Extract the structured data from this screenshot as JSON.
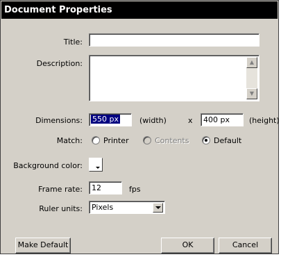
{
  "dialog": {
    "title": "Document Properties"
  },
  "form": {
    "title_label": "Title:",
    "title_value": "",
    "description_label": "Description:",
    "description_value": "",
    "dimensions_label": "Dimensions:",
    "width_value": "550 px",
    "width_unit": "(width)",
    "times": "x",
    "height_value": "400 px",
    "height_unit": "(height)",
    "match_label": "Match:",
    "match_options": [
      {
        "label": "Printer",
        "selected": false,
        "enabled": true
      },
      {
        "label": "Contents",
        "selected": false,
        "enabled": false
      },
      {
        "label": "Default",
        "selected": true,
        "enabled": true
      }
    ],
    "bg_label": "Background color:",
    "bg_color": "#ffffff",
    "frame_rate_label": "Frame rate:",
    "frame_rate_value": "12",
    "frame_rate_unit": "fps",
    "ruler_label": "Ruler units:",
    "ruler_value": "Pixels"
  },
  "buttons": {
    "make_default": "Make Default",
    "ok": "OK",
    "cancel": "Cancel"
  }
}
